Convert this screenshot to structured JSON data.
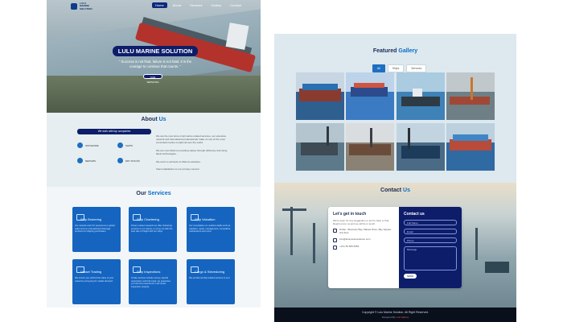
{
  "site": {
    "logo_text": "LULU MARINE SOLUTION",
    "nav": [
      "Home",
      "About",
      "Services",
      "Gallery",
      "Contact"
    ],
    "nav_active": "Home"
  },
  "hero": {
    "title": "LULU MARINE SOLUTION",
    "quote": "\" Success is not final, failure is not fatal; it is the courage to continue that counts. \"",
    "button": "OUR SERVICES"
  },
  "about": {
    "title_main": "About",
    "title_accent": "Us",
    "pill": "We work with top companies",
    "items": [
      "OFFSHORE",
      "SHIPS",
      "REPAIRS",
      "DRY DOCKS"
    ],
    "paragraphs": [
      "We are the new force of all marine related services, our extensive network and international professionals make us one of the most committed marine models all over the world.",
      "We are committed to providing values through efficiency and using latest technologies.",
      "We work on all kinds of offshore activities.",
      "Client satisfaction is our primary concern."
    ]
  },
  "services": {
    "title_main": "Our",
    "title_accent": "Services",
    "cards": [
      {
        "title": "Ship Brokering",
        "desc": "Our network and rich experience in global sales and our international brokerage services for shipping purchasers."
      },
      {
        "title": "Ship Chartering",
        "desc": "Driven market research we offer chartering services to our clients, to come out with the best rate of freight with our ships."
      },
      {
        "title": "Ship Valuation",
        "desc": "Our consultation on maritime fields such as valuation, repair, management, competitive, maintenance and more."
      },
      {
        "title": "Vessel Trading",
        "desc": "We ensure you will find the value of your vessel by surveying for market demand."
      },
      {
        "title": "Ship Inspections",
        "desc": "Onsite services include survey, special supervision and hull repair, we guarantee you the best experience in all vessel inspection projects."
      },
      {
        "title": "Cargo & Stevedoring",
        "desc": "We provide all ship related services in port."
      }
    ]
  },
  "gallery": {
    "title_main": "Featured",
    "title_accent": "Gallery",
    "filters": [
      "All",
      "Ships",
      "Services"
    ],
    "filter_active": "All"
  },
  "contact": {
    "title_main": "Contact",
    "title_accent": "Us",
    "left_heading": "Let's get in touch",
    "left_desc": "We're open for any suggestion or just to have a chat. Reach out to us and we will be in touch.",
    "address": "Dubai - Business Bay, Marasi Drive, Bay Square 2nd floor",
    "email": "info@lulumarinesolution.com",
    "phone": "+971 55 555 5555",
    "right_heading": "Contact us",
    "fields": [
      "Full Name",
      "Email",
      "Phone",
      "Message"
    ],
    "send": "SEND"
  },
  "footer": {
    "copyright": "Copyright © Lulu Marine Solution. All Right Reserved.",
    "credit_prefix": "Designed By",
    "credit_name": "Lulu Marine"
  },
  "colors": {
    "navy": "#0d1d6a",
    "accent_blue": "#0a6cc4",
    "service_blue": "#1565c0"
  }
}
